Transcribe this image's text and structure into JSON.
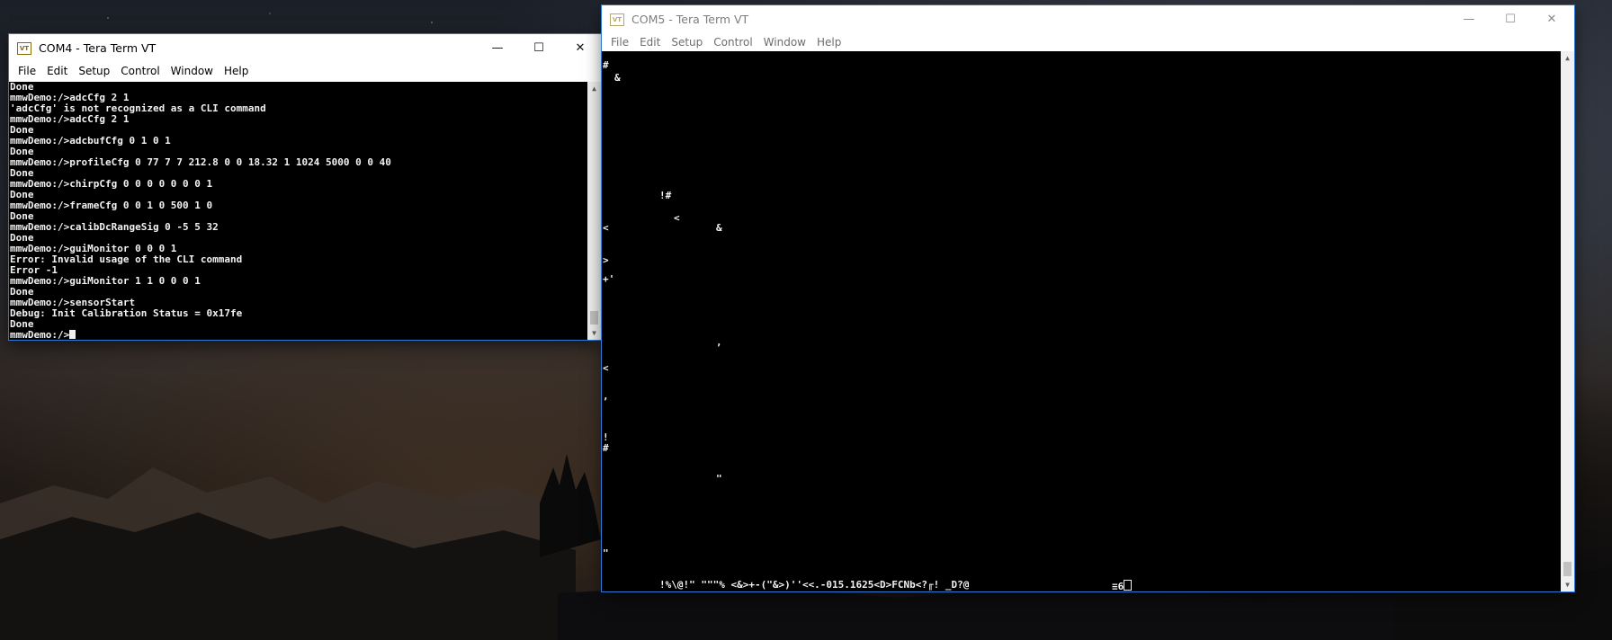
{
  "com4": {
    "title": "COM4 - Tera Term VT",
    "menu": [
      "File",
      "Edit",
      "Setup",
      "Control",
      "Window",
      "Help"
    ],
    "lines": [
      "Done",
      "mmwDemo:/>adcCfg 2 1",
      "'adcCfg' is not recognized as a CLI command",
      "mmwDemo:/>adcCfg 2 1",
      "Done",
      "mmwDemo:/>adcbufCfg 0 1 0 1",
      "Done",
      "mmwDemo:/>profileCfg 0 77 7 7 212.8 0 0 18.32 1 1024 5000 0 0 40",
      "Done",
      "mmwDemo:/>chirpCfg 0 0 0 0 0 0 0 1",
      "Done",
      "mmwDemo:/>frameCfg 0 0 1 0 500 1 0",
      "Done",
      "mmwDemo:/>calibDcRangeSig 0 -5 5 32",
      "Done",
      "mmwDemo:/>guiMonitor 0 0 0 1",
      "Error: Invalid usage of the CLI command",
      "Error -1",
      "mmwDemo:/>guiMonitor 1 1 0 0 0 1",
      "Done",
      "mmwDemo:/>sensorStart",
      "Debug: Init Calibration Status = 0x17fe",
      "Done"
    ],
    "prompt": "mmwDemo:/>"
  },
  "com5": {
    "title": "COM5 - Tera Term VT",
    "menu": [
      "File",
      "Edit",
      "Setup",
      "Control",
      "Window",
      "Help"
    ],
    "glyphs": {
      "g1": "#",
      "g2": "&",
      "g3": "!#",
      "g4": "<",
      "g5": "<",
      "g6": "&",
      "g7": ">",
      "g8": "+'",
      "g9": ",",
      "g10": "<",
      "g11": ",",
      "g12": "!",
      "g13": "#",
      "g14": "\"",
      "g15": "\"",
      "bottom_line": "!%\\@!\" \"\"\"% <&>+-(\"&>)''<<.-015.1625<D>FCNb<?╓! _D?@",
      "bottom_tail": "≡6"
    }
  },
  "window_controls": {
    "minimize": "—",
    "maximize": "☐",
    "close": "✕"
  }
}
